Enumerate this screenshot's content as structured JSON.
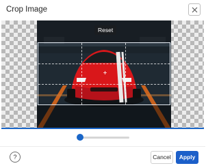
{
  "dialog": {
    "title": "Crop Image"
  },
  "icons": {
    "close": "close-icon",
    "help": "help-icon",
    "crop_center": "plus-icon"
  },
  "crop": {
    "reset_label": "Reset"
  },
  "zoom_slider": {
    "value": 0.0
  },
  "footer": {
    "help_label": "?",
    "cancel_label": "Cancel",
    "apply_label": "Apply"
  },
  "colors": {
    "accent": "#1c5fc9",
    "car": "#e01a1a"
  }
}
